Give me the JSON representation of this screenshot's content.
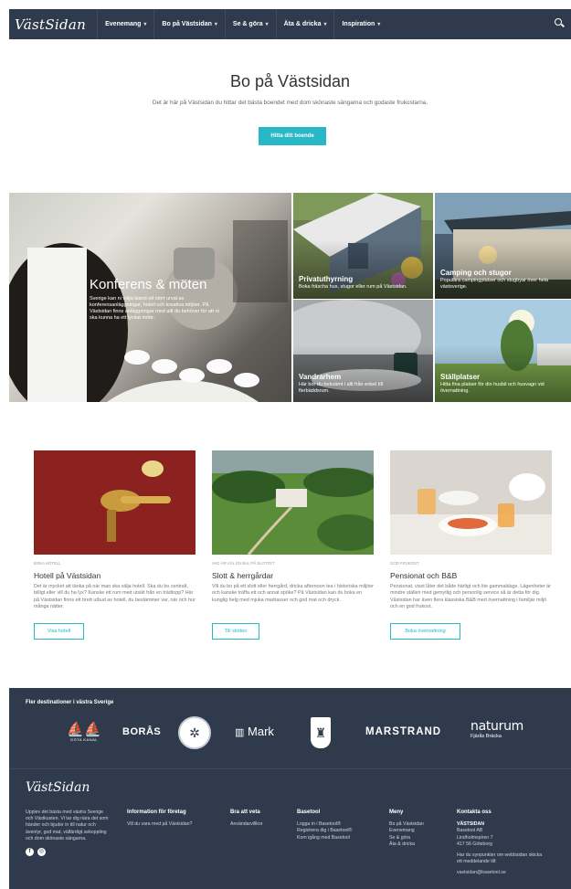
{
  "nav": {
    "logo": "VästSidan",
    "items": [
      {
        "label": "Evenemang"
      },
      {
        "label": "Bo på Västsidan"
      },
      {
        "label": "Se & göra"
      },
      {
        "label": "Äta & dricka"
      },
      {
        "label": "Inspiration"
      }
    ]
  },
  "hero": {
    "title": "Bo på Västsidan",
    "text": "Det är här på Västsidan du hittar det bästa boendet med dom skönaste sängarna och godaste frukostarna.",
    "button": "Hitta ditt boende"
  },
  "mosaic": {
    "conference": {
      "title": "Konferens & möten",
      "text": "Sverige kan ni välja bland ett stort urval av konferensanläggningar, hotell och kreativa miljöer. På Västsidan finns anläggningar med allt du behöver för att ni ska kunna ha ett lyckat möte."
    },
    "private": {
      "title": "Privatuthyrning",
      "text": "Boka fräscha hus, stugor eller rum på Västsidan."
    },
    "camping": {
      "title": "Camping och stugor",
      "text": "Populära campingplatser och stugbyar över hela västsverige."
    },
    "hostel": {
      "title": "Vandrarhem",
      "text": "Här bor du bekvämt i allt från enkel till flerbäddsrum."
    },
    "rv": {
      "title": "Ställplatser",
      "text": "Hitta fina platser för din husbil och husvagn vid övernattning."
    }
  },
  "cards": [
    {
      "kicker": "Boka Hotell",
      "title": "Hotell på Västsidan",
      "text": "Det är mycket att tänka på när man ska välja hotell. Ska du bo centralt, billigt eller vill du ha lyx? Kanske ett rum med utsikt från en trädtopp? Här på Västsidan finns ett brett utbud av hotell, du bestämmer var, när och hur många nätter.",
      "button": "Visa hotell"
    },
    {
      "kicker": "Vad är väl en bal på slottet",
      "title": "Slott & herrgårdar",
      "text": "Vill du bo på ett slott eller herrgård, dricka afternoon tea i historiska miljöer och kanske träffa ett och annat spöke? På Västsidan kan du boka en kunglig helg med mjuka madrasser och god mat och dryck.",
      "button": "Till slotten"
    },
    {
      "kicker": "God frukost",
      "title": "Pensionat och B&B",
      "text": "Pensionat, visst låter det både härligt och lite gammaldags. Lägenheter är mindre ställen med gemytlig och personlig service så är detta för dig. Västsidan har även flera klassiska B&B med övernattning i familjär miljö och en god frukost.",
      "button": "Boka övernattning"
    }
  ],
  "destinations": {
    "label": "Fler destinationer i västra Sverige",
    "logos": [
      "GÖTA KANAL",
      "BORÅS",
      "Mark",
      "MARSTRAND",
      "naturum",
      "Fjärås Bräcka"
    ]
  },
  "footer": {
    "logo": "VästSidan",
    "about": "Upplev det bästa med västra Sverige och Västkusten. Vi tar dig nära det som händer och bjuder in till natur och äventyr, god mat, välfärdigt avkoppling och dom skönaste sängarna.",
    "cols": [
      {
        "heading": "Information för företag",
        "links": [
          "Vill du vara med på Västsidan?"
        ]
      },
      {
        "heading": "Bra att veta",
        "links": [
          "Användarvillkor"
        ]
      },
      {
        "heading": "Basetool",
        "links": [
          "Logga in i Basetool®",
          "Registrera dig i Basetool®",
          "Kom igång med Basetool"
        ]
      },
      {
        "heading": "Meny",
        "links": [
          "Bo på Västsidan",
          "Evenemang",
          "Se & göra",
          "Äta & dricka"
        ]
      },
      {
        "heading": "Kontakta oss",
        "links": [
          "VÄSTSIDAN",
          "Basetool AB",
          "Lindholmspiren 7",
          "417 56 Göteborg",
          "",
          "Har du synpunkter om webbsidan skicka ett meddelande till:",
          "",
          "vastsidan@basetool.se"
        ]
      }
    ]
  }
}
